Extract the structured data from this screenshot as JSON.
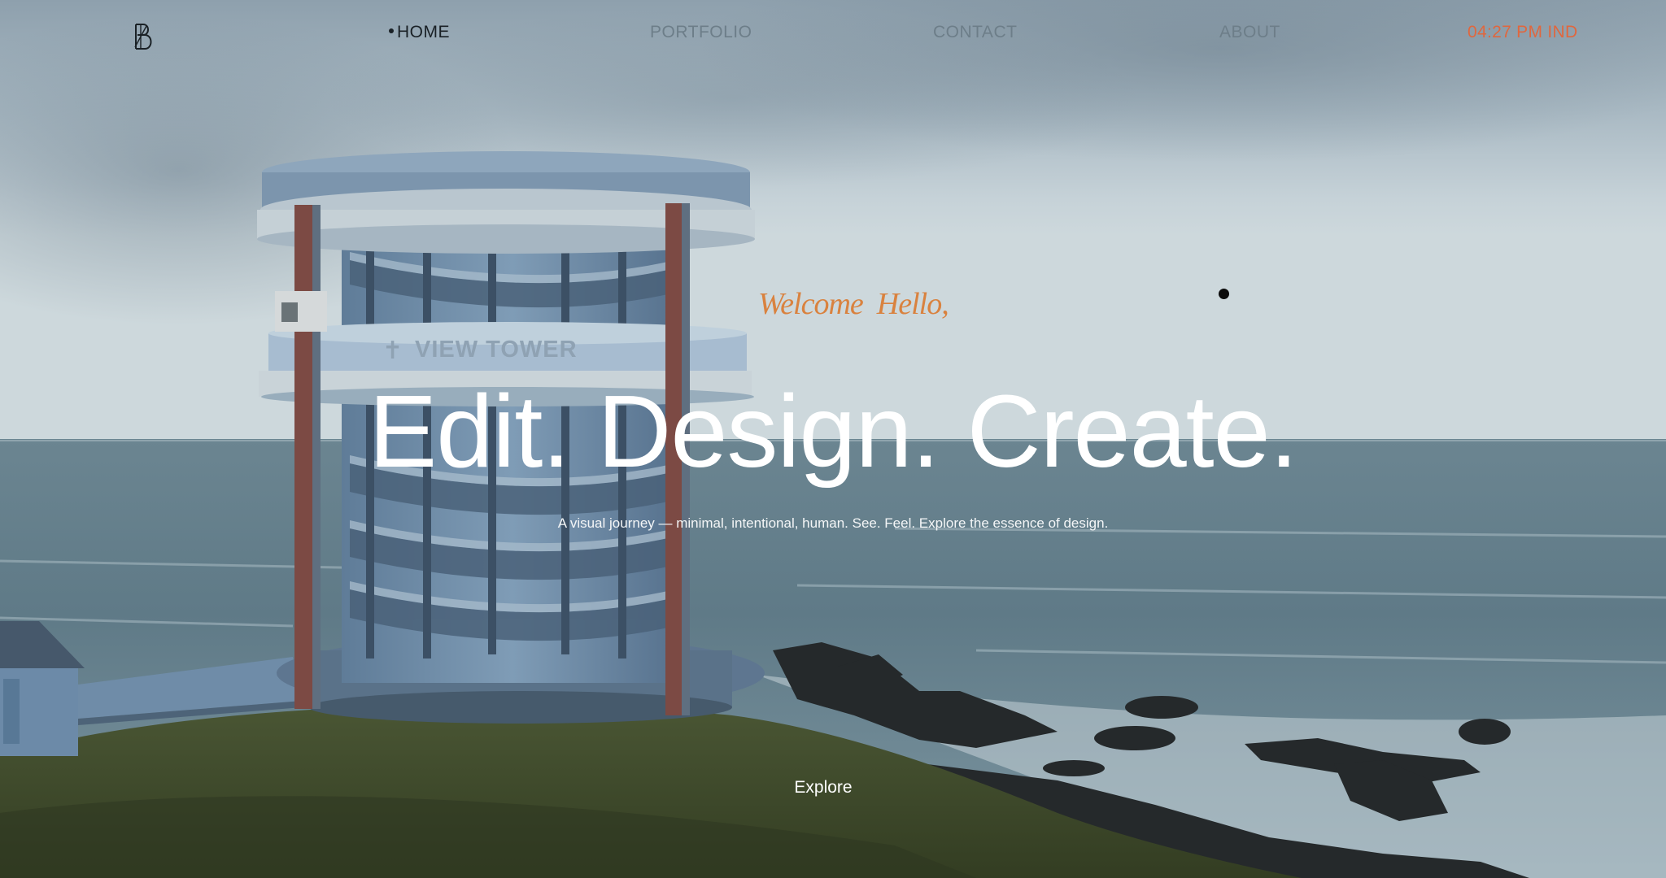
{
  "nav": {
    "logo_alt": "BS monogram",
    "items": [
      {
        "label": "HOME",
        "active": true
      },
      {
        "label": "PORTFOLIO",
        "active": false
      },
      {
        "label": "CONTACT",
        "active": false
      },
      {
        "label": "ABOUT",
        "active": false
      }
    ],
    "clock": "04:27 PM IND"
  },
  "hero": {
    "welcome": "Welcome  Hello,",
    "headline": "Edit. Design. Create.",
    "subline": "A visual journey — minimal, intentional, human. See. Feel. Explore the essence of design.",
    "cta_label": "Explore",
    "tower_sign": "VIEW TOWER"
  },
  "colors": {
    "accent": "#e0673e",
    "welcome": "#d9823f",
    "nav_active": "#1a2126",
    "nav_inactive": "#6d7e89",
    "headline": "#ffffff"
  }
}
